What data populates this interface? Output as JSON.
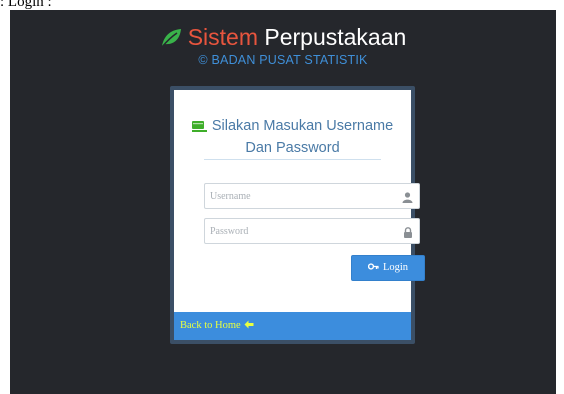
{
  "document": {
    "caption": ": Login :"
  },
  "header": {
    "brand_word1": "Sistem",
    "brand_word2": "Perpustakaan",
    "subtitle": "© BADAN PUSAT STATISTIK"
  },
  "login_card": {
    "title_line1": "Silakan Masukan Username",
    "title_line2": "Dan Password",
    "username_placeholder": "Username",
    "password_placeholder": "Password",
    "username_icon": "user-icon",
    "password_icon": "lock-icon",
    "login_label": "Login",
    "login_icon": "key-icon"
  },
  "footer": {
    "back_label": "Back to Home",
    "back_icon": "arrow-left-icon"
  },
  "colors": {
    "background": "#25272c",
    "brand_red": "#e8553e",
    "brand_leaf": "#39b34a",
    "subtitle_blue": "#3f8fd8",
    "primary_blue": "#3c8ddd",
    "link_yellow": "#e8ff40"
  }
}
